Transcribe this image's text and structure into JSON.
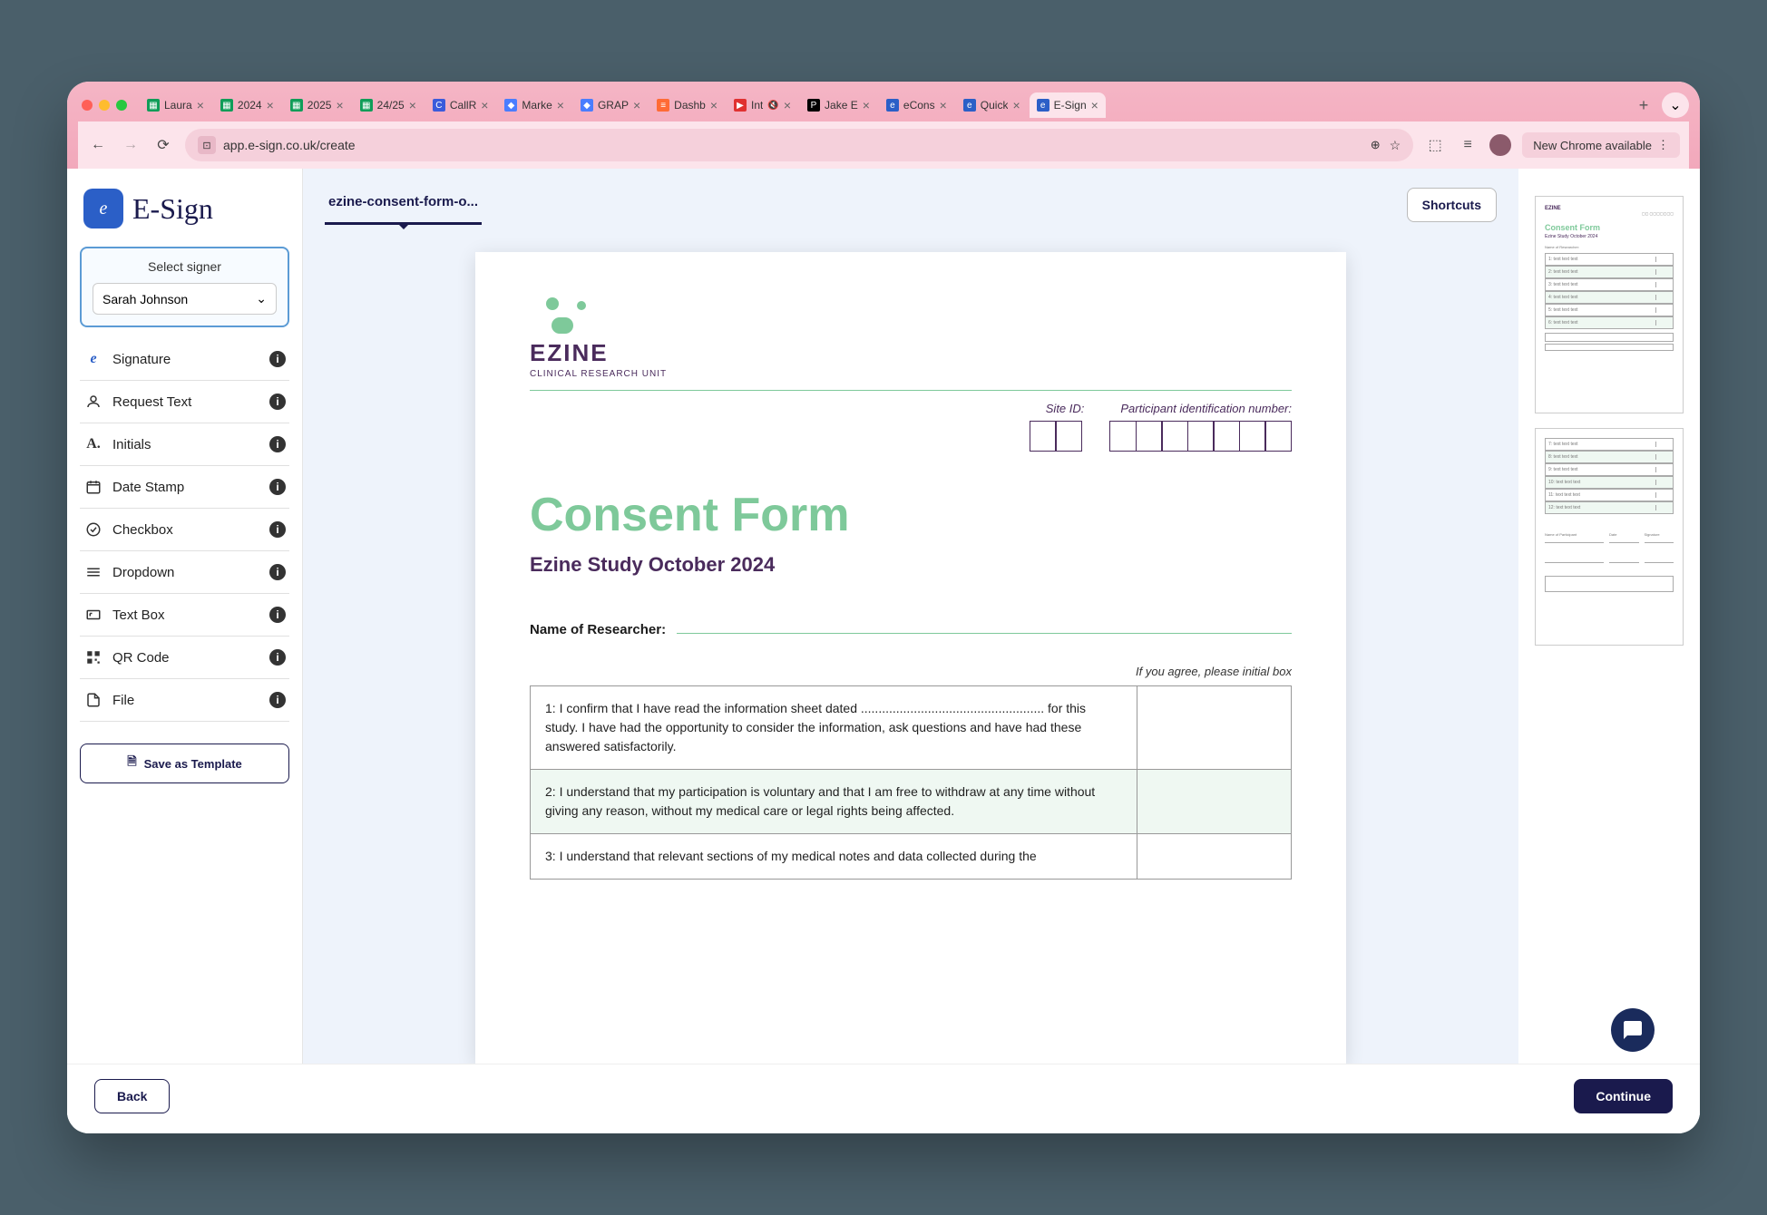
{
  "browser": {
    "url": "app.e-sign.co.uk/create",
    "newChromeLabel": "New Chrome available",
    "tabs": [
      {
        "title": "Laura",
        "faviconBg": "#0f9d58",
        "faviconText": "▦"
      },
      {
        "title": "2024",
        "faviconBg": "#0f9d58",
        "faviconText": "▦"
      },
      {
        "title": "2025",
        "faviconBg": "#0f9d58",
        "faviconText": "▦"
      },
      {
        "title": "24/25",
        "faviconBg": "#0f9d58",
        "faviconText": "▦"
      },
      {
        "title": "CallR",
        "faviconBg": "#3b5bdb",
        "faviconText": "C"
      },
      {
        "title": "Marke",
        "faviconBg": "#4a7dff",
        "faviconText": "◆"
      },
      {
        "title": "GRAP",
        "faviconBg": "#4a7dff",
        "faviconText": "◆"
      },
      {
        "title": "Dashb",
        "faviconBg": "#ff6b35",
        "faviconText": "≡"
      },
      {
        "title": "Int",
        "faviconBg": "#e03131",
        "faviconText": "▶",
        "muted": true
      },
      {
        "title": "Jake E",
        "faviconBg": "#000",
        "faviconText": "P"
      },
      {
        "title": "eCons",
        "faviconBg": "#2b5fc7",
        "faviconText": "e"
      },
      {
        "title": "Quick",
        "faviconBg": "#2b5fc7",
        "faviconText": "e"
      },
      {
        "title": "E-Sign",
        "faviconBg": "#2b5fc7",
        "faviconText": "e",
        "active": true
      }
    ]
  },
  "app": {
    "brand": "E-Sign",
    "docTab": "ezine-consent-form-o...",
    "shortcuts": "Shortcuts",
    "signer": {
      "label": "Select signer",
      "value": "Sarah Johnson"
    },
    "tools": [
      {
        "label": "Signature",
        "icon": "signature"
      },
      {
        "label": "Request Text",
        "icon": "request-text"
      },
      {
        "label": "Initials",
        "icon": "initials"
      },
      {
        "label": "Date Stamp",
        "icon": "date-stamp"
      },
      {
        "label": "Checkbox",
        "icon": "checkbox"
      },
      {
        "label": "Dropdown",
        "icon": "dropdown"
      },
      {
        "label": "Text Box",
        "icon": "text-box"
      },
      {
        "label": "QR Code",
        "icon": "qr-code"
      },
      {
        "label": "File",
        "icon": "file"
      }
    ],
    "saveTemplate": "Save as Template",
    "back": "Back",
    "continue": "Continue"
  },
  "document": {
    "logoName": "EZINE",
    "logoSub": "CLINICAL RESEARCH UNIT",
    "siteIdLabel": "Site ID:",
    "pinLabel": "Participant identification number:",
    "title": "Consent Form",
    "subtitle": "Ezine Study October 2024",
    "researcherLabel": "Name of Researcher:",
    "agreeNote": "If you agree, please initial box",
    "items": [
      "1:   I confirm that I have read the information sheet dated .................................................... for this study. I have had the opportunity to consider the information, ask questions and have had these answered satisfactorily.",
      "2:   I understand that my participation is voluntary and that I am free to withdraw at any time without giving any reason, without my medical care or legal rights being affected.",
      "3:   I understand that relevant sections of my medical notes and data collected during the"
    ]
  }
}
